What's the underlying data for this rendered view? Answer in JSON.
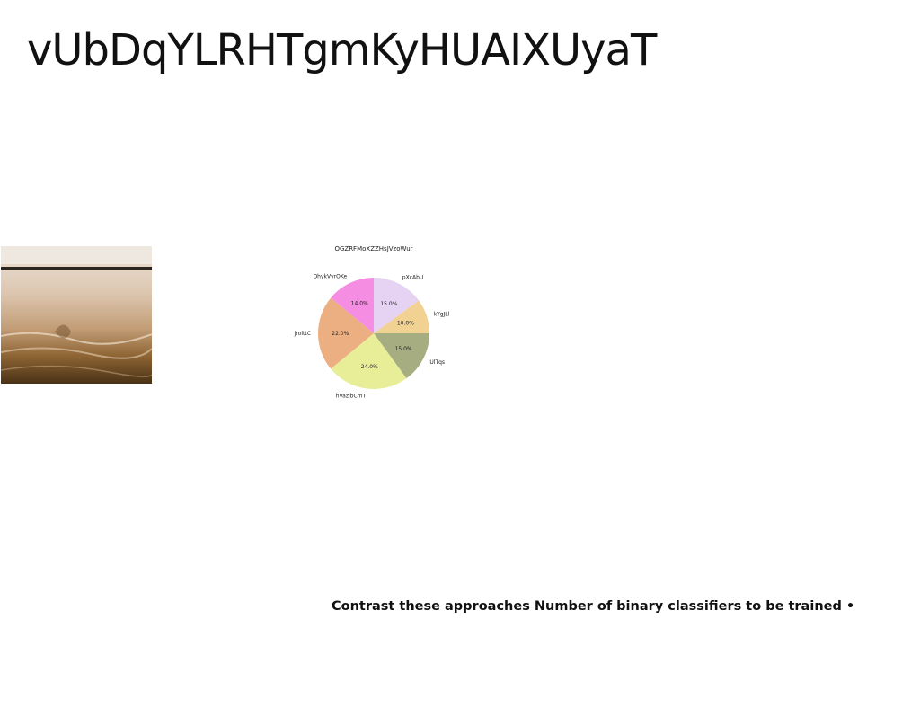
{
  "title": "vUbDqYLRHTgmKyHUAIXUyaT",
  "caption": "Contrast these approaches Number of binary classifiers to be trained •",
  "chart_data": {
    "type": "pie",
    "title": "OGZRFMoXZZHsJVzoWur",
    "start_angle_deg": 90,
    "direction": "clockwise",
    "slices": [
      {
        "label": "pXcAbU",
        "value": 15.0,
        "pct_label": "15.0%",
        "color": "#e6d2f2"
      },
      {
        "label": "kYgJLl",
        "value": 10.0,
        "pct_label": "10.0%",
        "color": "#f1d292"
      },
      {
        "label": "UlTqs",
        "value": 15.0,
        "pct_label": "15.0%",
        "color": "#a6ad80"
      },
      {
        "label": "hVazlbCmT",
        "value": 24.0,
        "pct_label": "24.0%",
        "color": "#e8ee98"
      },
      {
        "label": "jrolttC",
        "value": 22.0,
        "pct_label": "22.0%",
        "color": "#ecaf82"
      },
      {
        "label": "DhykVvrOKe",
        "value": 14.0,
        "pct_label": "14.0%",
        "color": "#f58de2"
      }
    ]
  }
}
